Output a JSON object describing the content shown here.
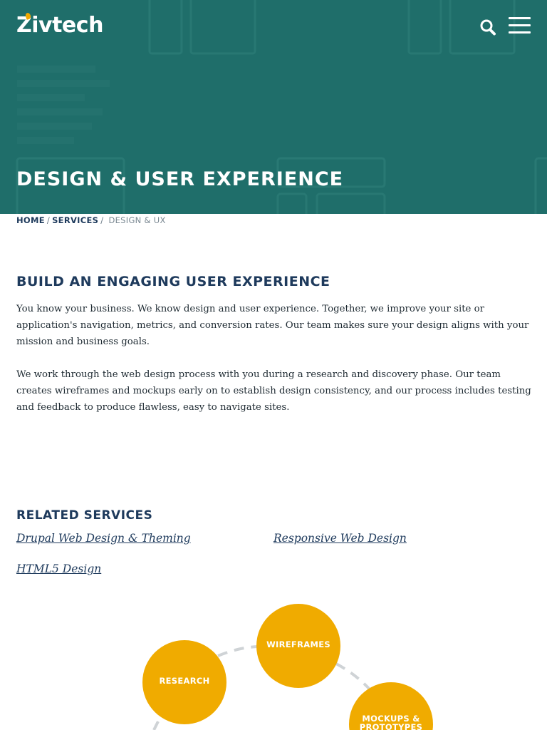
{
  "header": {
    "logo_text": "Zivtech",
    "search_icon": "search-icon",
    "menu_icon": "hamburger-menu-icon",
    "hero_title": "DESIGN & USER EXPERIENCE",
    "colors": {
      "hero_bg": "#1f6e6a",
      "accent": "#f0a800"
    }
  },
  "breadcrumb": {
    "items": [
      {
        "label": "HOME"
      },
      {
        "label": "SERVICES"
      }
    ],
    "separator": "/",
    "current": "DESIGN & UX"
  },
  "main": {
    "heading": "BUILD AN ENGAGING USER EXPERIENCE",
    "paragraphs": [
      "You know your business. We know design and user experience. Together, we improve your site or application's navigation, metrics, and conversion rates. Our team makes sure your design aligns with your mission and business goals.",
      "We work through the web design process with you during a research and discovery phase. Our team creates wireframes and mockups early on to establish design consistency, and our process includes testing and feedback to produce flawless, easy to navigate sites."
    ]
  },
  "related": {
    "heading": "RELATED SERVICES",
    "links": [
      "Drupal Web Design & Theming",
      "Responsive Web Design",
      "HTML5 Design"
    ]
  },
  "process": {
    "color": "#f0ab00",
    "steps": [
      {
        "label": "RESEARCH"
      },
      {
        "label": "WIREFRAMES"
      },
      {
        "label_line1": "MOCKUPS &",
        "label_line2": "PROTOTYPES"
      }
    ]
  }
}
